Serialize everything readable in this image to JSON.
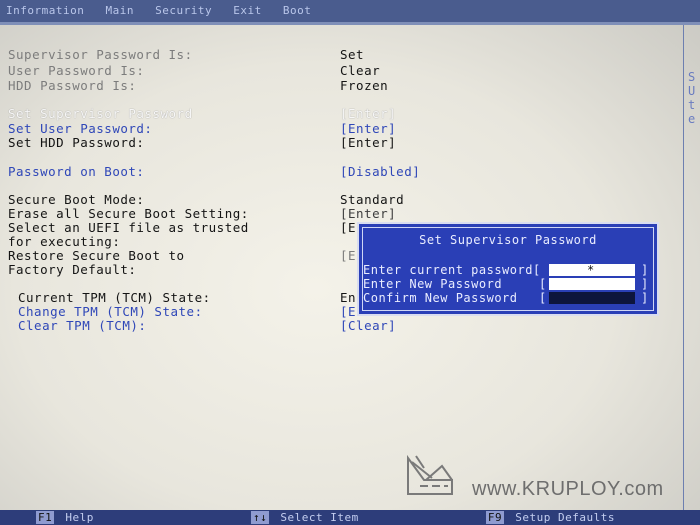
{
  "header": {
    "tabs": [
      "Information",
      "Main",
      "Security",
      "Exit",
      "Boot"
    ]
  },
  "security": {
    "rows": [
      {
        "label": "Supervisor Password Is:",
        "value": "Set"
      },
      {
        "label": "User Password Is:",
        "value": "Clear"
      },
      {
        "label": "HDD Password Is:",
        "value": "Frozen"
      },
      {
        "label": "Set Supervisor Password",
        "value": "[Enter]"
      },
      {
        "label": "Set User Password:",
        "value": "[Enter]"
      },
      {
        "label": "Set HDD Password:",
        "value": "[Enter]"
      },
      {
        "label": "Password on Boot:",
        "value": "[Disabled]"
      },
      {
        "label": "Secure Boot Mode:",
        "value": "Standard"
      },
      {
        "label": "Erase all Secure Boot Setting:",
        "value": "[Enter]"
      },
      {
        "label": "Select an UEFI file as trusted",
        "value": "[E"
      },
      {
        "label": "for executing:",
        "value": ""
      },
      {
        "label": "Restore Secure Boot to",
        "value": "[E"
      },
      {
        "label": "Factory Default:",
        "value": ""
      },
      {
        "label": "Current TPM (TCM) State:",
        "value": "En"
      },
      {
        "label": "Change TPM (TCM) State:",
        "value": "[E"
      },
      {
        "label": "Clear TPM (TCM):",
        "value": "[Clear]"
      }
    ]
  },
  "dialog": {
    "title": "Set Supervisor Password",
    "current_label": "Enter current password[",
    "new_label": "Enter New Password",
    "confirm_label": "Confirm New Password",
    "left_bracket": "[",
    "right_bracket": "]",
    "masked_input": "*"
  },
  "footer": {
    "f1_key": "F1",
    "f1_label": "Help",
    "arrow_key": "↑↓",
    "arrow_label": "Select Item",
    "f9_key": "F9",
    "f9_label": "Setup Defaults"
  },
  "side_panel": {
    "fragments": [
      "S",
      "U",
      "t",
      "e"
    ]
  },
  "watermark": {
    "text": "www.KRUPLOY.com"
  },
  "colors": {
    "dialog_bg": "#2a3fb6",
    "header_bg": "#4a5c8e",
    "selected_text": "#f7f7f7",
    "link_text": "#2f47b8"
  }
}
